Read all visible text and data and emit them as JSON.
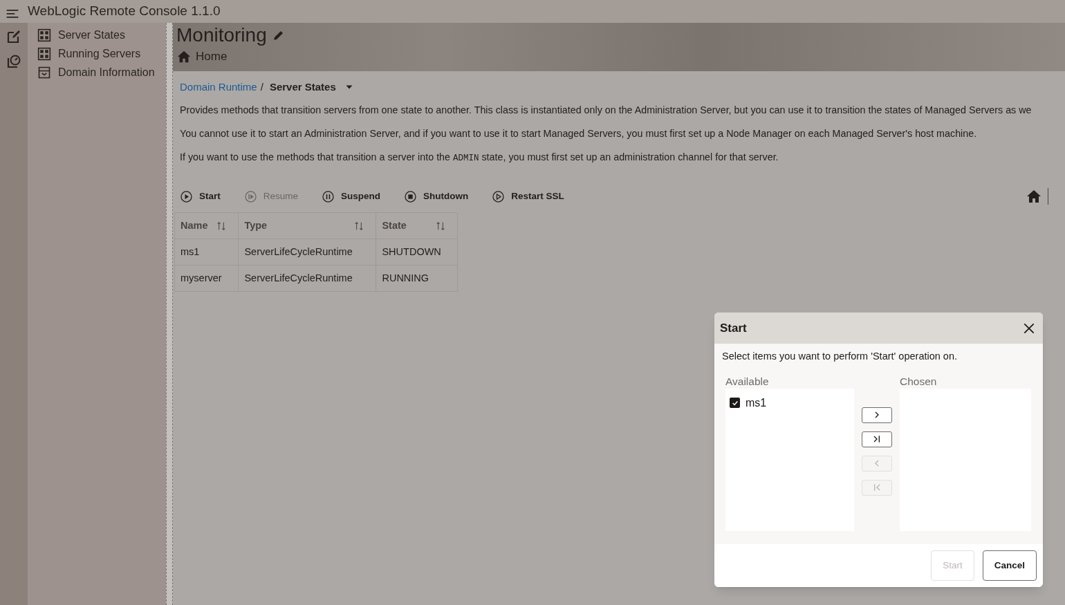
{
  "app_title": "WebLogic Remote Console 1.1.0",
  "nav": [
    {
      "label": "Server States"
    },
    {
      "label": "Running Servers"
    },
    {
      "label": "Domain Information"
    }
  ],
  "page": {
    "title": "Monitoring",
    "home_link": "Home"
  },
  "breadcrumb": {
    "parent": "Domain Runtime",
    "separator": "/",
    "current": "Server States"
  },
  "description": [
    "Provides methods that transition servers from one state to another. This class is instantiated only on the Administration Server, but you can use it to transition the states of Managed Servers as we",
    "You cannot use it to start an Administration Server, and if you want to use it to start Managed Servers, you must first set up a Node Manager on each Managed Server's host machine.",
    {
      "before": "If you want to use the methods that transition a server into the",
      "code": "ADMIN",
      "after": "state, you must first set up an administration channel for that server."
    }
  ],
  "actions": [
    {
      "label": "Start",
      "disabled": false
    },
    {
      "label": "Resume",
      "disabled": true
    },
    {
      "label": "Suspend",
      "disabled": false
    },
    {
      "label": "Shutdown",
      "disabled": false
    },
    {
      "label": "Restart SSL",
      "disabled": false
    }
  ],
  "table": {
    "columns": [
      "Name",
      "Type",
      "State"
    ],
    "rows": [
      [
        "ms1",
        "ServerLifeCycleRuntime",
        "SHUTDOWN"
      ],
      [
        "myserver",
        "ServerLifeCycleRuntime",
        "RUNNING"
      ]
    ]
  },
  "dialog": {
    "title": "Start",
    "instruction": "Select items you want to perform 'Start' operation on.",
    "available_label": "Available",
    "chosen_label": "Chosen",
    "available": [
      {
        "label": "ms1",
        "checked": true
      }
    ],
    "shuttle_buttons": [
      {
        "kind": "move",
        "disabled": false
      },
      {
        "kind": "move-all",
        "disabled": false
      },
      {
        "kind": "remove",
        "disabled": true
      },
      {
        "kind": "remove-all",
        "disabled": true
      }
    ],
    "buttons": [
      {
        "label": "Start",
        "disabled": true
      },
      {
        "label": "Cancel",
        "disabled": false
      }
    ]
  }
}
